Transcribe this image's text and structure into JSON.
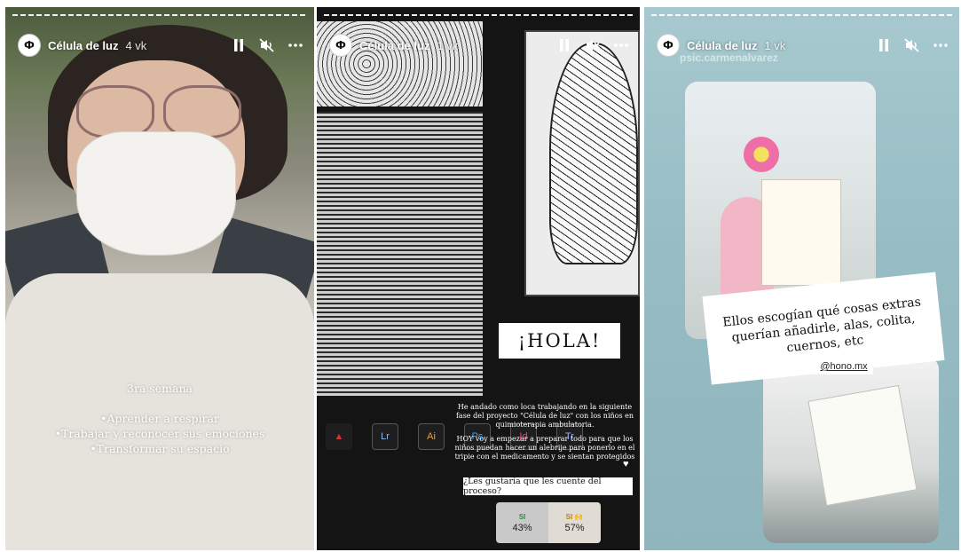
{
  "stories": [
    {
      "account": "Célula de luz",
      "time": "4 vk",
      "avatar_glyph": "Ф",
      "title_line": "3ra semana",
      "bullets": [
        "•Aprender a respirar",
        "•Trabajar y reconocer sus emociones",
        "•Transformar su espacio"
      ],
      "icons": {
        "pause": "pause-icon",
        "mute": "mute-icon",
        "more": "more-icon"
      }
    },
    {
      "account": "Célula de luz",
      "time": "1 vk",
      "avatar_glyph": "Ф",
      "greeting": "¡HOLA!",
      "tools": [
        "Lr",
        "Ai",
        "Ps",
        "Id",
        "Tr"
      ],
      "paragraph_1": "He andado como loca trabajando en la siguiente fase del proyecto \"Célula de luz\" con los niños en quimioterapia ambulatoria.",
      "paragraph_2": "HOY voy a empezar a preparar todo para que los niños puedan hacer un alebrije para ponerlo en el tripie con el medicamento y se sientan protegidos",
      "question": "¿Les gustaría que les cuente del proceso?",
      "poll": [
        {
          "label": "SI",
          "percent": "43%"
        },
        {
          "label": "SI 🙌",
          "percent": "57%"
        }
      ],
      "icons": {
        "pause": "pause-icon",
        "mute": "volume-off-icon",
        "more": "more-icon"
      }
    },
    {
      "account": "Célula de luz",
      "time": "1 vk",
      "avatar_glyph": "Ф",
      "handle": "psic.carmenalvarez",
      "caption": "Ellos escogían qué cosas extras querían añadirle, alas, colita, cuernos, etc",
      "tag": "@hono.mx",
      "icons": {
        "pause": "pause-icon",
        "mute": "mute-icon",
        "more": "more-icon"
      }
    }
  ]
}
